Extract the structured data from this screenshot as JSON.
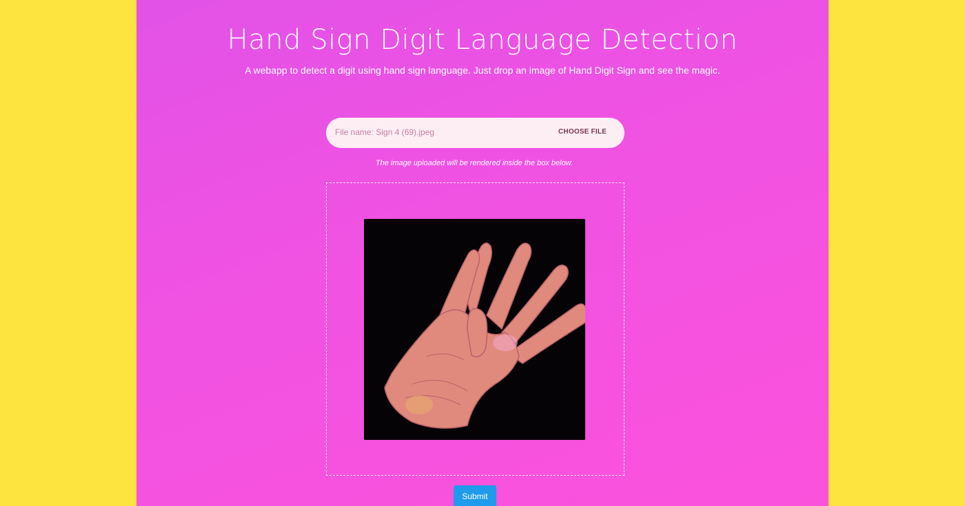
{
  "header": {
    "title": "Hand Sign Digit Language Detection",
    "subtitle": "A webapp to detect a digit using hand sign language. Just drop an image of Hand Digit Sign and see the magic."
  },
  "upload": {
    "file_name": "File name: Sign 4 (69).jpeg",
    "choose_file_label": "CHOOSE FILE",
    "hint": "The image uploaded will be rendered inside the box below."
  },
  "preview": {
    "image_icon": "hand-sign-four-image"
  },
  "actions": {
    "submit_label": "Submit"
  },
  "colors": {
    "background": "#fde43f",
    "panel_gradient_start": "#e252e7",
    "panel_gradient_end": "#fb52dc",
    "file_field": "#fdeef4",
    "submit_button": "#1e9bea"
  }
}
